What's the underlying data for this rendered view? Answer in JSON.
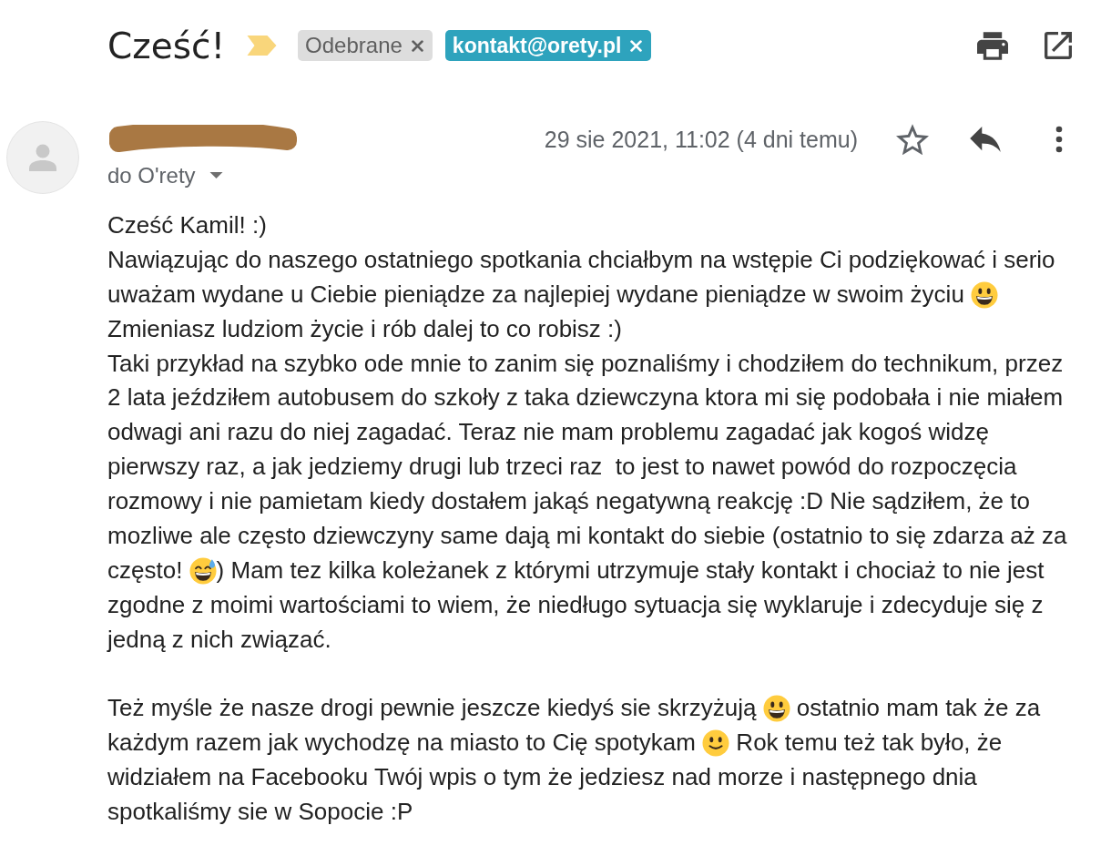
{
  "subject": {
    "title": "Cześć!",
    "important": true,
    "labels": [
      {
        "text": "Odebrane",
        "color": "#dddddd"
      },
      {
        "text": "kontakt@orety.pl",
        "color": "#2ea3bd"
      }
    ]
  },
  "message": {
    "recipient": "do O'rety",
    "date": "29 sie 2021, 11:02 (4 dni temu)",
    "starred": false
  },
  "body": {
    "paragraphs": [
      {
        "lines": [
          [
            {
              "kind": "text",
              "text": "Cześć Kamil! :)"
            }
          ],
          [
            {
              "kind": "text",
              "text": "Nawiązując do naszego ostatniego spotkania chciałbym na wstępie Ci podziękować i serio"
            }
          ],
          [
            {
              "kind": "text",
              "text": "uważam wydane u Ciebie pieniądze za najlepiej wydane pieniądze w swoim życiu "
            },
            {
              "kind": "grinning"
            }
          ],
          [
            {
              "kind": "text",
              "text": "Zmieniasz ludziom życie i rób dalej to co robisz :)"
            }
          ],
          [
            {
              "kind": "text",
              "text": "Taki przykład na szybko ode mnie to zanim się poznaliśmy i chodziłem do technikum, przez"
            }
          ],
          [
            {
              "kind": "text",
              "text": "2 lata jeździłem autobusem do szkoły z taka dziewczyna ktora mi się podobała i nie miałem"
            }
          ],
          [
            {
              "kind": "text",
              "text": "odwagi ani razu do niej zagadać. Teraz nie mam problemu zagadać jak kogoś widzę"
            }
          ],
          [
            {
              "kind": "text",
              "text": "pierwszy raz, a jak jedziemy drugi lub trzeci raz  to jest to nawet powód do rozpoczęcia"
            }
          ],
          [
            {
              "kind": "text",
              "text": "rozmowy i nie pamietam kiedy dostałem jakąś negatywną reakcję :D Nie sądziłem, że to"
            }
          ],
          [
            {
              "kind": "text",
              "text": "mozliwe ale często dziewczyny same dają mi kontakt do siebie (ostatnio to się zdarza aż za"
            }
          ],
          [
            {
              "kind": "text",
              "text": "często! "
            },
            {
              "kind": "sweat"
            },
            {
              "kind": "text",
              "text": ") Mam tez kilka koleżanek z którymi utrzymuje stały kontakt i chociaż to nie jest"
            }
          ],
          [
            {
              "kind": "text",
              "text": "zgodne z moimi wartościami to wiem, że niedługo sytuacja się wyklaruje i zdecyduje się z"
            }
          ],
          [
            {
              "kind": "text",
              "text": "jedną z nich związać."
            }
          ]
        ]
      },
      {
        "lines": [
          [
            {
              "kind": "text",
              "text": "Też myśle że nasze drogi pewnie jeszcze kiedyś sie skrzyżują "
            },
            {
              "kind": "grinning"
            },
            {
              "kind": "text",
              "text": " ostatnio mam tak że za"
            }
          ],
          [
            {
              "kind": "text",
              "text": "każdym razem jak wychodzę na miasto to Cię spotykam "
            },
            {
              "kind": "smiling"
            },
            {
              "kind": "text",
              "text": " Rok temu też tak było, że"
            }
          ],
          [
            {
              "kind": "text",
              "text": "widziałem na Facebooku Twój wpis o tym że jedziesz nad morze i następnego dnia"
            }
          ],
          [
            {
              "kind": "text",
              "text": "spotkaliśmy sie w Sopocie :P"
            }
          ]
        ]
      }
    ]
  }
}
